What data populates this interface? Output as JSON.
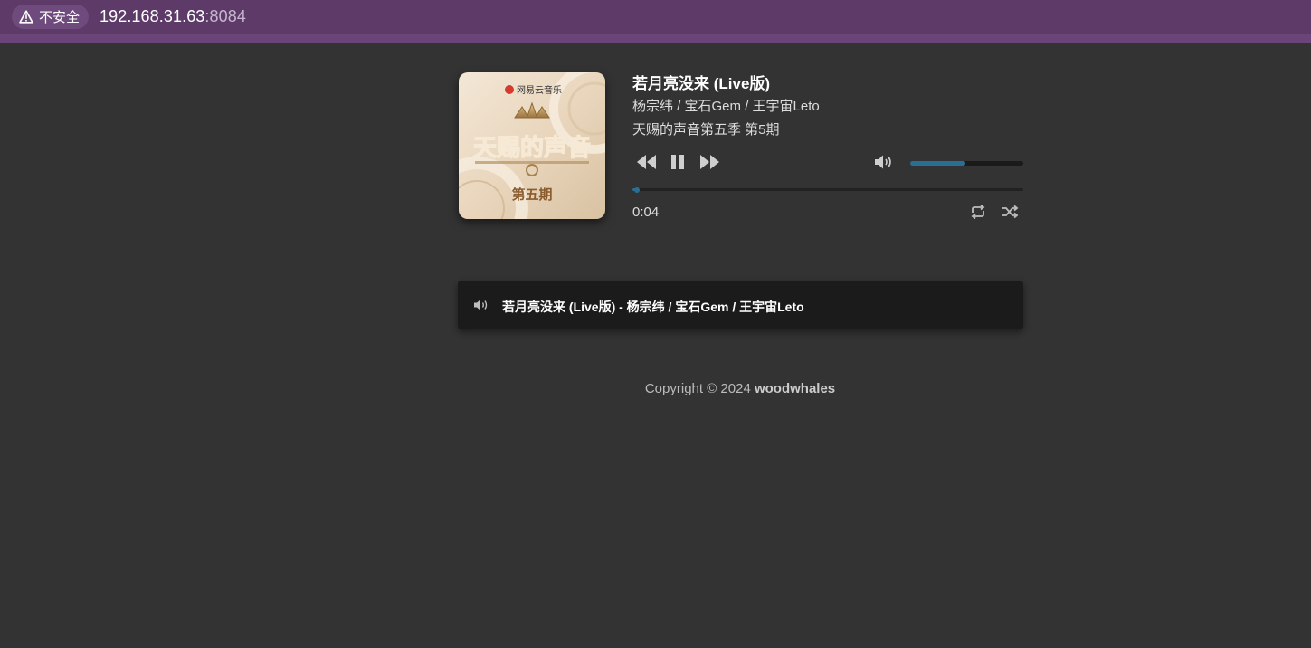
{
  "browser": {
    "security_label": "不安全",
    "url_host": "192.168.31.63",
    "url_port": ":8084"
  },
  "player": {
    "title": "若月亮没来 (Live版)",
    "artists": "杨宗纬 / 宝石Gem / 王宇宙Leto",
    "album": "天赐的声音第五季 第5期",
    "cover": {
      "logo_text": "网易云音乐",
      "show_title": "天赐的声音",
      "episode_text": "第五期"
    },
    "current_time": "0:04",
    "volume_fraction": 0.49,
    "progress_fraction": 0.012,
    "accent_color": "#2a6f93",
    "icons": {
      "prev": "rewind-icon",
      "play_pause": "pause-icon",
      "next": "fast-forward-icon",
      "volume": "volume-icon",
      "repeat": "repeat-icon",
      "shuffle": "shuffle-icon"
    }
  },
  "playlist": {
    "items": [
      {
        "label": "若月亮没来 (Live版) - 杨宗纬 / 宝石Gem / 王宇宙Leto",
        "playing": true
      }
    ]
  },
  "footer": {
    "prefix": "Copyright © 2024",
    "author": "woodwhales"
  }
}
